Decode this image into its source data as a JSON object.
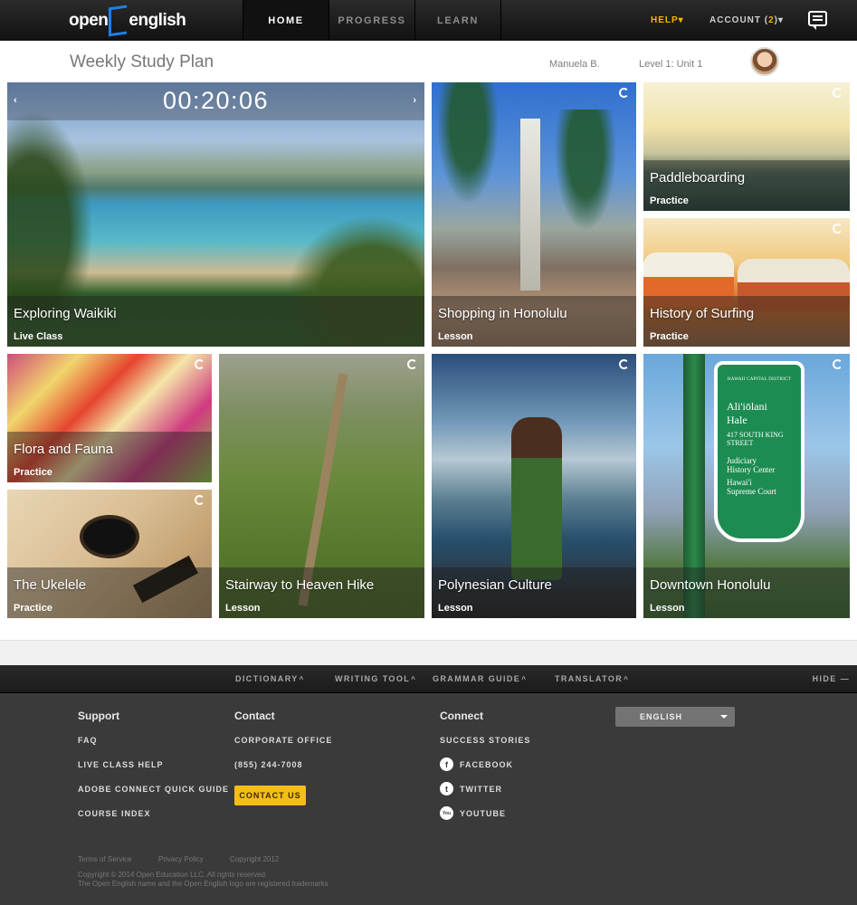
{
  "brand": {
    "logo_left": "open",
    "logo_right": "english",
    "accent_color": "#f0b400",
    "logo_color": "#1f7ff0"
  },
  "nav": {
    "tabs": [
      {
        "label": "HOME",
        "active": true
      },
      {
        "label": "PROGRESS",
        "active": false
      },
      {
        "label": "LEARN",
        "active": false
      }
    ],
    "help": "HELP",
    "account_label": "ACCOUNT",
    "account_count": "2",
    "caret": "▾"
  },
  "header": {
    "title": "Weekly Study Plan",
    "user_name": "Manuela B.",
    "level": "Level 1:  Unit 1"
  },
  "featured": {
    "timer": "00:20:06",
    "prev": "‹",
    "next": "›"
  },
  "tiles": [
    {
      "name": "Exploring Waikiki",
      "type": "Live Class"
    },
    {
      "name": "Shopping in Honolulu",
      "type": "Lesson"
    },
    {
      "name": "Paddleboarding",
      "type": "Practice"
    },
    {
      "name": "History of Surfing",
      "type": "Practice"
    },
    {
      "name": "Flora and Fauna",
      "type": "Practice"
    },
    {
      "name": "The Ukelele",
      "type": "Practice"
    },
    {
      "name": "Stairway to Heaven Hike",
      "type": "Lesson"
    },
    {
      "name": "Polynesian Culture",
      "type": "Lesson"
    },
    {
      "name": "Downtown Honolulu",
      "type": "Lesson"
    }
  ],
  "sign_text": {
    "line1": "HAWAII CAPITAL DISTRICT",
    "line2": "Ali'iōlani",
    "line3": "Hale",
    "line4": "417 SOUTH KING",
    "line5": "STREET",
    "line6": "Judiciary",
    "line7": "History Center",
    "line8": "Hawai'i",
    "line9": "Supreme Court"
  },
  "toolbar": {
    "tools": [
      {
        "label": "DICTIONARY"
      },
      {
        "label": "WRITING TOOL"
      },
      {
        "label": "GRAMMAR GUIDE"
      },
      {
        "label": "TRANSLATOR"
      }
    ],
    "caret_up": "^",
    "hide": "HIDE  —"
  },
  "footer": {
    "support": {
      "heading": "Support",
      "links": [
        "FAQ",
        "LIVE CLASS HELP",
        "ADOBE CONNECT QUICK GUIDE",
        "COURSE INDEX"
      ]
    },
    "contact": {
      "heading": "Contact",
      "links": [
        "CORPORATE OFFICE",
        "(855) 244-7008"
      ],
      "button": "CONTACT US"
    },
    "connect": {
      "heading": "Connect",
      "stories": "SUCCESS STORIES",
      "social": [
        {
          "label": "FACEBOOK",
          "glyph": "f"
        },
        {
          "label": "TWITTER",
          "glyph": "t"
        },
        {
          "label": "YOUTUBE",
          "glyph": "You"
        }
      ]
    },
    "language": {
      "selected": "ENGLISH"
    },
    "legal": {
      "terms": "Terms of Service",
      "privacy": "Privacy Policy",
      "copyright_year": "Copyright 2012",
      "copyright_line": "Copyright © 2014 Open Education LLC. All rights reserved",
      "trademark": "The Open English name and the Open English logo are registered trademarks"
    }
  }
}
